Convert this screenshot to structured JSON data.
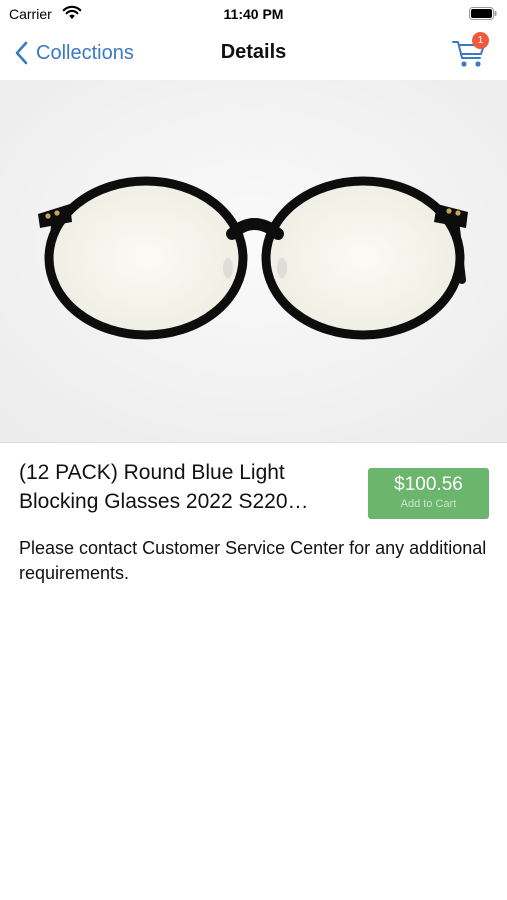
{
  "status_bar": {
    "carrier": "Carrier",
    "time": "11:40 PM"
  },
  "nav": {
    "back_label": "Collections",
    "title": "Details",
    "cart_count": "1"
  },
  "product": {
    "title": "(12 PACK) Round Blue Light Blocking Glasses 2022 S220…",
    "price": "$100.56",
    "add_to_cart_label": "Add to Cart",
    "description": "Please contact Customer Service Center for any additional requirements."
  },
  "colors": {
    "accent": "#3a79c4",
    "price_button": "#6cb56c",
    "badge": "#ee5a3c"
  },
  "icons": [
    "wifi-icon",
    "battery-icon",
    "back-chevron-icon",
    "cart-icon"
  ]
}
